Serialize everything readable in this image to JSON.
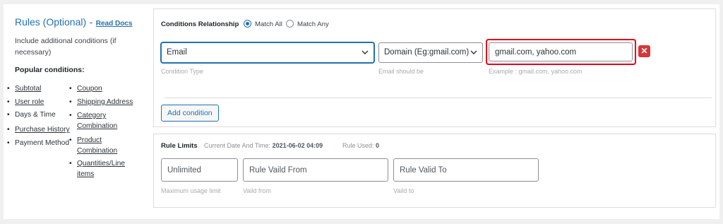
{
  "left": {
    "title": "Rules (Optional)",
    "separator": "-",
    "read_docs": "Read Docs",
    "description": "Include additional conditions (if necessary)",
    "popular_heading": "Popular conditions:",
    "col1": [
      "Subtotal",
      "User role",
      "Days & Time",
      "Purchase History",
      "Payment Method"
    ],
    "col2": [
      "Coupon",
      "Shipping Address",
      "Category Combination",
      "Product Combination",
      "Quantities/Line items"
    ]
  },
  "conditions": {
    "relationship_label": "Conditions Relationship",
    "match_all": "Match All",
    "match_any": "Match Any",
    "selected_match": "Match All",
    "condition_type_value": "Email",
    "operator_value": "Domain (Eg:gmail.com)",
    "value_input": "gmail.com, yahoo.com",
    "hint_condition_type": "Condition Type",
    "hint_operator": "Email should be",
    "hint_value": "Example : gmail.com, yahoo.com",
    "add_condition_label": "Add condition",
    "remove_icon": "close-icon",
    "highlight_color": "#e3001b"
  },
  "limits": {
    "title": "Rule Limits",
    "current_date_label": "Current Date And Time:",
    "current_date_value": "2021-06-02 04:09",
    "rule_used_label": "Rule Used:",
    "rule_used_value": "0",
    "usage_placeholder": "Unlimited",
    "from_placeholder": "Rule Vaild From",
    "to_placeholder": "Rule Valid To",
    "hint_usage": "Maximum usage limit",
    "hint_from": "Vaild from",
    "hint_to": "Vaild to"
  },
  "colors": {
    "accent": "#2271b1",
    "danger": "#d63638"
  }
}
